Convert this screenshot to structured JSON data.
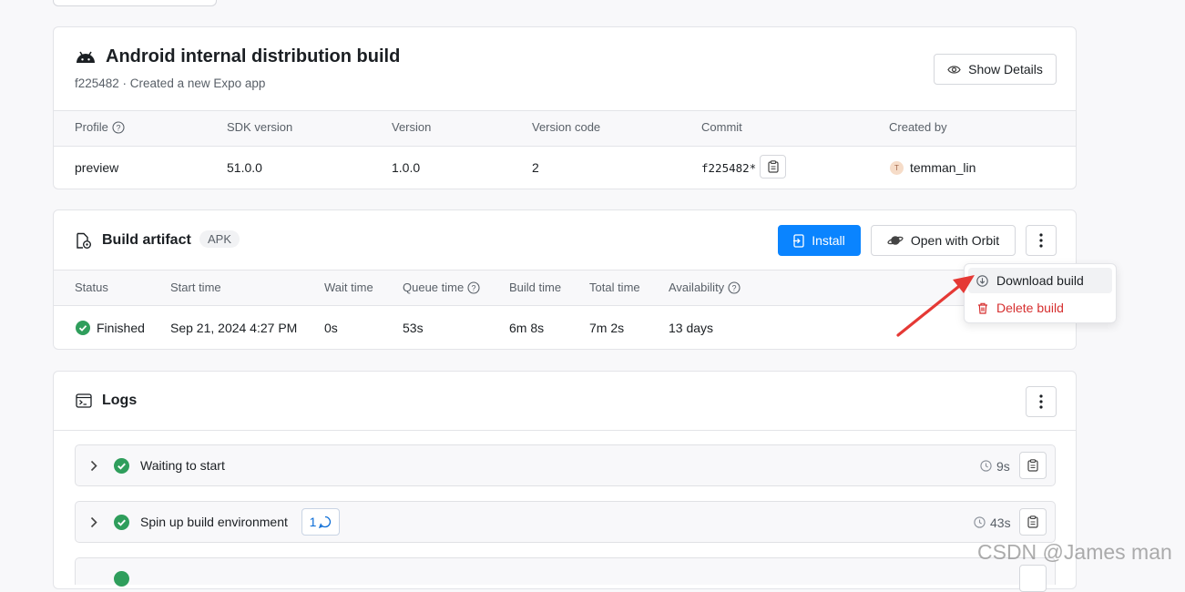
{
  "build_card": {
    "title": "Android internal distribution build",
    "subtitle": "f225482 · Created a new Expo app",
    "show_details_label": "Show Details",
    "columns": [
      "Profile",
      "SDK version",
      "Version",
      "Version code",
      "Commit",
      "Created by"
    ],
    "row": {
      "profile": "preview",
      "sdk_version": "51.0.0",
      "version": "1.0.0",
      "version_code": "2",
      "commit": "f225482*",
      "avatar_initial": "T",
      "created_by": "temman_lin"
    }
  },
  "artifact_card": {
    "title": "Build artifact",
    "badge": "APK",
    "install_label": "Install",
    "orbit_label": "Open with Orbit",
    "columns": [
      "Status",
      "Start time",
      "Wait time",
      "Queue time",
      "Build time",
      "Total time",
      "Availability"
    ],
    "row": {
      "status": "Finished",
      "start_time": "Sep 21, 2024 4:27 PM",
      "wait_time": "0s",
      "queue_time": "53s",
      "build_time": "6m 8s",
      "total_time": "7m 2s",
      "availability": "13 days"
    }
  },
  "menu": {
    "download": "Download build",
    "delete": "Delete build"
  },
  "logs_card": {
    "title": "Logs",
    "items": [
      {
        "title": "Waiting to start",
        "duration": "9s"
      },
      {
        "title": "Spin up build environment",
        "duration": "43s",
        "badge_count": "1"
      }
    ]
  },
  "watermark": "CSDN @James man",
  "colors": {
    "primary": "#0a84ff",
    "success": "#2f9e5c",
    "danger": "#d62f2f",
    "annotation_arrow": "#e53935"
  }
}
